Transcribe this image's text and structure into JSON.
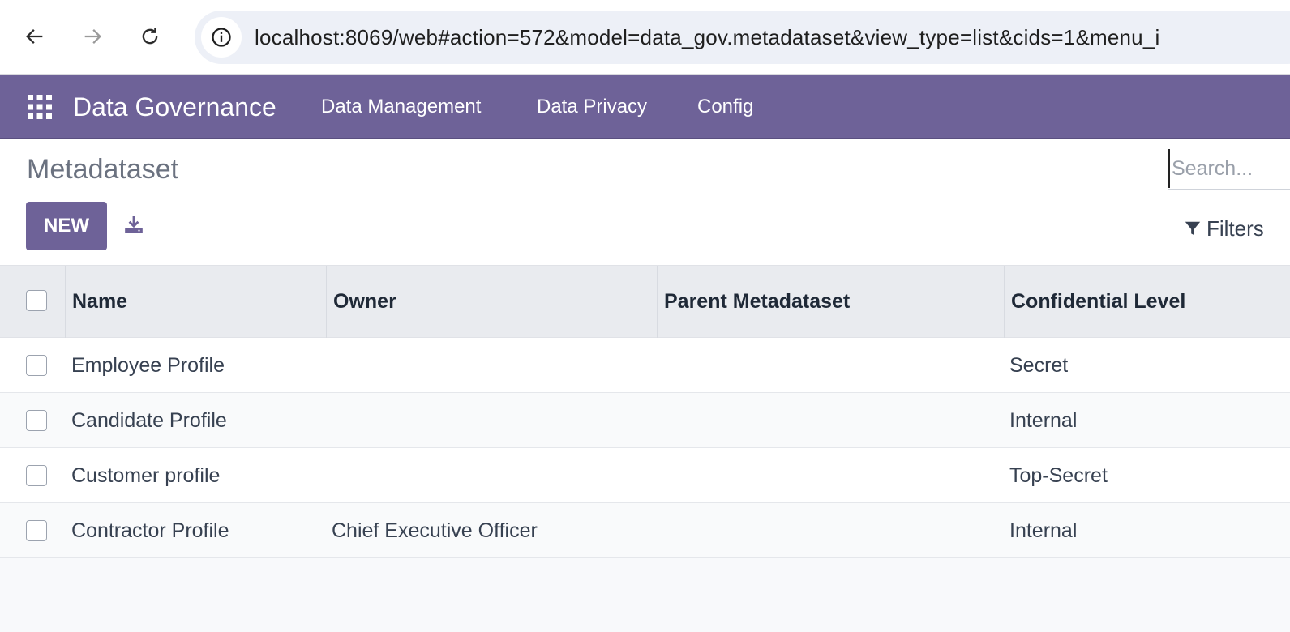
{
  "browser": {
    "url": "localhost:8069/web#action=572&model=data_gov.metadataset&view_type=list&cids=1&menu_i"
  },
  "navbar": {
    "brand": "Data Governance",
    "menu": [
      "Data Management",
      "Data Privacy",
      "Config"
    ]
  },
  "control": {
    "title": "Metadataset",
    "new_label": "NEW",
    "search_placeholder": "Search...",
    "filters_label": "Filters"
  },
  "table": {
    "columns": [
      "Name",
      "Owner",
      "Parent Metadataset",
      "Confidential Level"
    ],
    "rows": [
      {
        "name": "Employee Profile",
        "owner": "",
        "parent": "",
        "level": "Secret"
      },
      {
        "name": "Candidate Profile",
        "owner": "",
        "parent": "",
        "level": "Internal"
      },
      {
        "name": "Customer profile",
        "owner": "",
        "parent": "",
        "level": "Top-Secret"
      },
      {
        "name": "Contractor Profile",
        "owner": "Chief Executive Officer",
        "parent": "",
        "level": "Internal"
      }
    ]
  },
  "colors": {
    "brand": "#6e6298",
    "header_bg": "#e9ebef"
  },
  "icons": [
    "back-arrow-icon",
    "forward-arrow-icon",
    "reload-icon",
    "site-info-icon",
    "apps-grid-icon",
    "download-icon",
    "filter-icon"
  ]
}
